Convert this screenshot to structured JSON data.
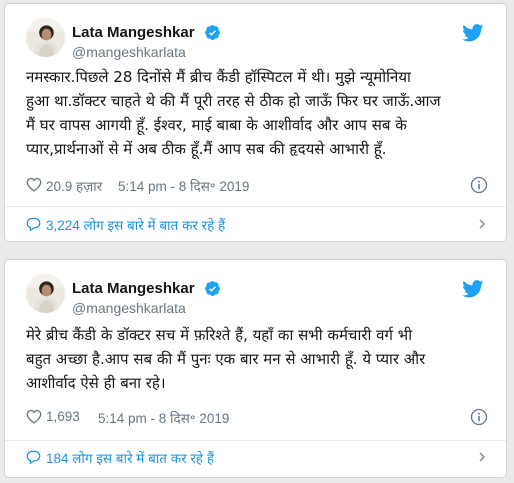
{
  "colors": {
    "background": "#eaeaea",
    "card": "#ffffff",
    "text": "#14171a",
    "muted": "#657786",
    "link": "#1b95e0",
    "verified": "#1da1f2",
    "twitter_brand": "#1da1f2"
  },
  "icons": {
    "verified": "verified-badge-icon",
    "logo": "twitter-bird-icon",
    "like": "heart-icon",
    "info": "info-icon",
    "reply": "speech-bubble-icon",
    "more": "chevron-right-icon"
  },
  "tweets": [
    {
      "author": {
        "name": "Lata Mangeshkar",
        "handle": "@mangeshkarlata"
      },
      "text_lines": [
        "नमस्कार.पिछले 28 दिनोंसे मैं ब्रीच कैंडी हॉस्पिटल में थी। मुझे न्यूमोनिया",
        "हुआ था.डॉक्टर चाहते थे की मैं पूरी तरह से ठीक हो जाऊँ फिर घर जाऊँ.आज",
        "मैं घर वापस आगयी हूँ. ईश्वर, माई बाबा के आशीर्वाद और आप सब के",
        "प्यार,प्रार्थनाओं से में अब ठीक हूँ.मैं आप सब की हृदयसे आभारी हूँ."
      ],
      "likes": "20.9 हज़ार",
      "timestamp": "5:14 pm - 8 दिस॰ 2019",
      "conversation": "3,224 लोग इस बारे में बात कर रहे हैं"
    },
    {
      "author": {
        "name": "Lata Mangeshkar",
        "handle": "@mangeshkarlata"
      },
      "text_lines": [
        "मेरे ब्रीच कैंडी के डॉक्टर सच में फ़रिश्ते हैं, यहाँ का सभी कर्मचारी वर्ग भी",
        "बहुत अच्छा है.आप सब की मैं पुनः एक बार मन से आभारी हूँ. ये प्यार और",
        "आशीर्वाद ऐसे ही बना रहे।"
      ],
      "likes": "1,693",
      "timestamp": "5:14 pm - 8 दिस॰ 2019",
      "conversation": "184 लोग इस बारे में बात कर रहे हैं"
    }
  ]
}
